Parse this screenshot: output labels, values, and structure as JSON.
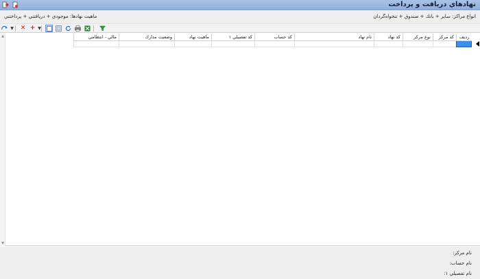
{
  "window": {
    "title": "نهادهاي دریافت و پرداخت"
  },
  "filters": {
    "center_types": "انواع مراكز: سایر + بانك + صندوق + تنخواه‌گردان",
    "entity_nature": "ماهیت نهادها: موجودي + دریافتني + پرداختني"
  },
  "toolbar": {
    "items": [
      "filter-icon",
      "excel-icon",
      "print-icon",
      "refresh-icon",
      "view-icon",
      "select-icon",
      "add-icon",
      "dropdown-icon",
      "delete-icon",
      "dropdown-icon",
      "navigate-icon"
    ]
  },
  "grid": {
    "columns": [
      "ردیف",
      "كد مركز",
      "نوع مركز",
      "كد نهاد",
      "نام نهاد",
      "كد حساب",
      "كد تفصیلي ۱",
      "ماهیت نهاد",
      "وضعیت مدارك",
      "مالي - انتظامي"
    ],
    "rows": [
      [
        "",
        "",
        "",
        "",
        "",
        "",
        "",
        "",
        "",
        ""
      ]
    ]
  },
  "details": {
    "center_name_label": "نام مركز:",
    "account_name_label": "نام حساب:",
    "detail1_name_label": "نام تفصیلي ۱:"
  },
  "colors": {
    "title_bg": "#a9c3e6",
    "selection": "#3d8ee8"
  }
}
